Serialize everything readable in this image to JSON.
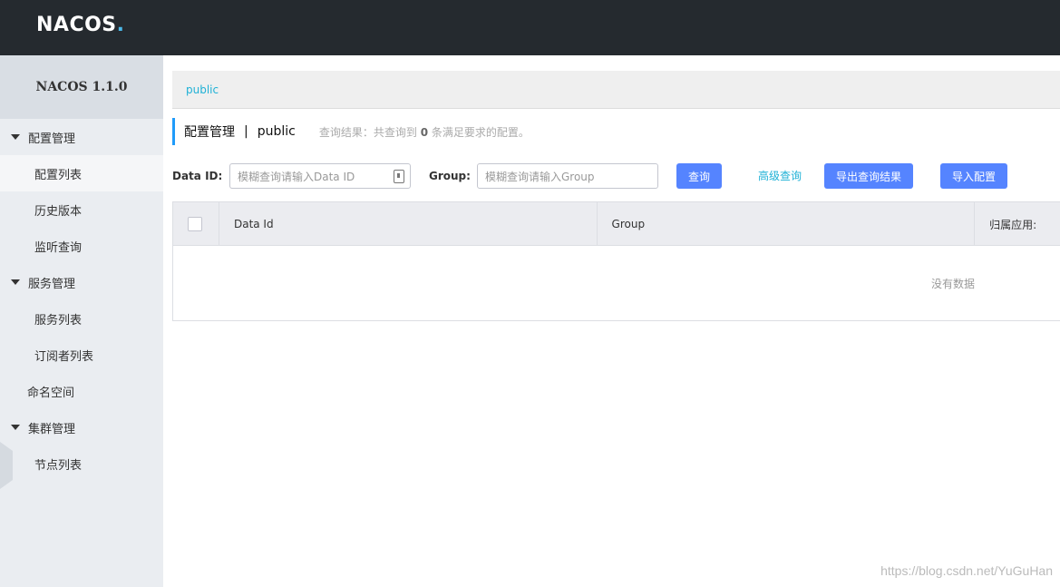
{
  "app": {
    "logo_text": "NACOS",
    "logo_dot": "."
  },
  "sidebar": {
    "version": "NACOS 1.1.0",
    "groups": [
      {
        "label": "配置管理",
        "items": [
          "配置列表",
          "历史版本",
          "监听查询"
        ]
      },
      {
        "label": "服务管理",
        "items": [
          "服务列表",
          "订阅者列表"
        ]
      },
      {
        "label": "命名空间",
        "items": []
      },
      {
        "label": "集群管理",
        "items": [
          "节点列表"
        ]
      }
    ],
    "active_item": "配置列表"
  },
  "breadcrumb": {
    "namespace": "public"
  },
  "page": {
    "title": "配置管理",
    "separator": "|",
    "namespace": "public",
    "result_prefix": "查询结果：共查询到",
    "result_count": "0",
    "result_suffix": "条满足要求的配置。"
  },
  "search": {
    "data_id_label": "Data ID:",
    "data_id_placeholder": "模糊查询请输入Data ID",
    "group_label": "Group:",
    "group_placeholder": "模糊查询请输入Group",
    "query_button": "查询",
    "advanced_link": "高级查询",
    "export_button": "导出查询结果",
    "import_button": "导入配置"
  },
  "table": {
    "columns": [
      "Data Id",
      "Group",
      "归属应用:"
    ],
    "empty_text": "没有数据"
  },
  "watermark": "https://blog.csdn.net/YuGuHan",
  "colors": {
    "topbar": "#252a2f",
    "accent": "#5584ff",
    "link": "#1fb1d6"
  }
}
